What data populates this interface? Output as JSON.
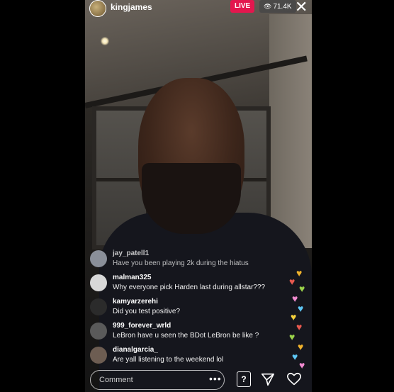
{
  "header": {
    "username": "kingjames",
    "live_label": "LIVE",
    "viewer_count": "71.4K"
  },
  "comments": [
    {
      "user": "jay_patell1",
      "text": "Have you been playing 2k during the hiatus",
      "avatar_color": "#8a8f99"
    },
    {
      "user": "malman325",
      "text": "Why everyone pick Harden last during allstar???",
      "avatar_color": "#d8d8d8"
    },
    {
      "user": "kamyarzerehi",
      "text": "Did you test positive?",
      "avatar_color": "#2b2b2b"
    },
    {
      "user": "999_forever_wrld",
      "text": "LeBron have u seen the BDot LeBron be like ?",
      "avatar_color": "#5a5a5a"
    },
    {
      "user": "dianalgarcia_",
      "text": "Are yall listening to the weekend lol",
      "avatar_color": "#6d5d52"
    }
  ],
  "footer": {
    "comment_placeholder": "Comment",
    "more_label": "•••",
    "question_label": "?"
  },
  "colors": {
    "live": "#e3174e",
    "hearts": [
      "#f0b22c",
      "#e8594f",
      "#9bd34a",
      "#f28bd1",
      "#5ec7f5",
      "#f6d03b"
    ]
  }
}
